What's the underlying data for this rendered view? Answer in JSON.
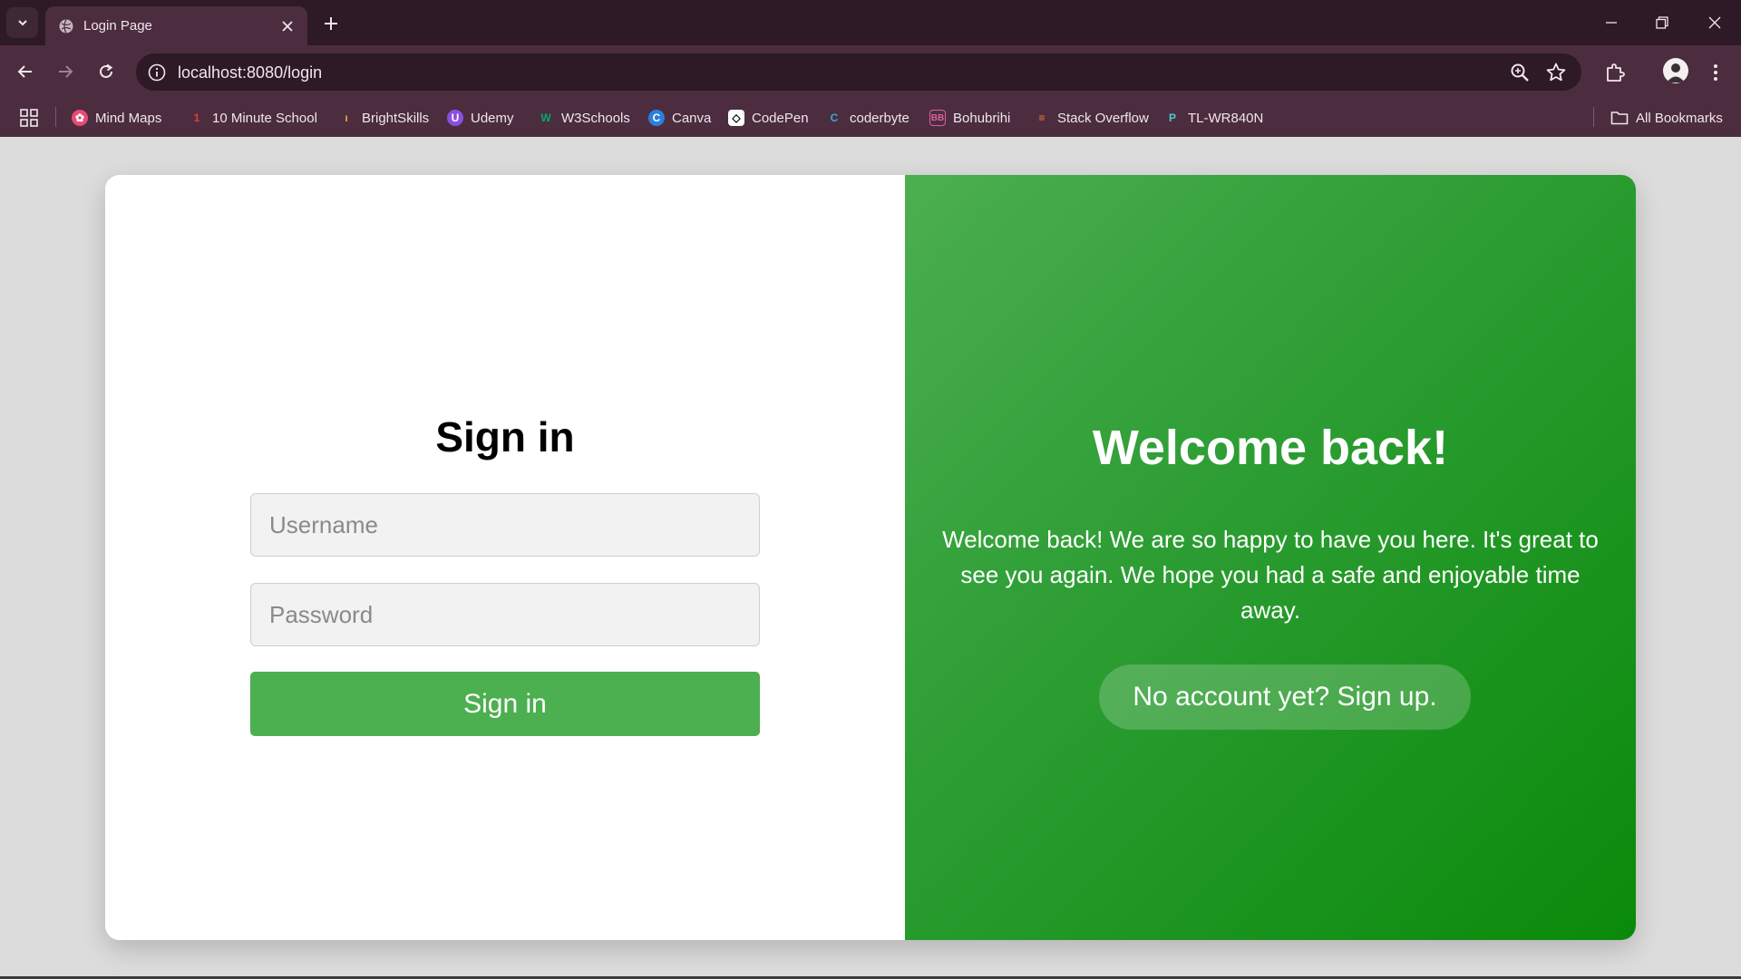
{
  "browser": {
    "tab_title": "Login Page",
    "url": "localhost:8080/login"
  },
  "bookmarks": {
    "items": [
      {
        "label": "Mind Maps",
        "icon": "mindmaps-icon",
        "color": "#e84a73"
      },
      {
        "label": "10 Minute School",
        "icon": "10ms-icon",
        "color": "#e53935"
      },
      {
        "label": "BrightSkills",
        "icon": "brightskills-icon",
        "color": "#f5a623"
      },
      {
        "label": "Udemy",
        "icon": "udemy-icon",
        "color": "#8c4fe0"
      },
      {
        "label": "W3Schools",
        "icon": "w3schools-icon",
        "color": "#04aa6d"
      },
      {
        "label": "Canva",
        "icon": "canva-icon",
        "color": "#2c7fe0"
      },
      {
        "label": "CodePen",
        "icon": "codepen-icon",
        "color": "#ffffff"
      },
      {
        "label": "coderbyte",
        "icon": "coderbyte-icon",
        "color": "#3aa8d8"
      },
      {
        "label": "Bohubrihi",
        "icon": "bohubrihi-icon",
        "color": "#c2185b"
      },
      {
        "label": "Stack Overflow",
        "icon": "stackoverflow-icon",
        "color": "#f48024"
      },
      {
        "label": "TL-WR840N",
        "icon": "tplink-icon",
        "color": "#4acbd6"
      }
    ],
    "all_bookmarks": "All Bookmarks"
  },
  "signin": {
    "title": "Sign in",
    "username_placeholder": "Username",
    "password_placeholder": "Password",
    "button": "Sign in"
  },
  "welcome": {
    "title": "Welcome back!",
    "text": "Welcome back! We are so happy to have you here. It's great to see you again. We hope you had a safe and enjoyable time away.",
    "signup_button": "No account yet? Sign up."
  },
  "colors": {
    "accent": "#4caf50",
    "panel_dark": "#0a8a0a",
    "chrome": "#4b2d3f"
  }
}
